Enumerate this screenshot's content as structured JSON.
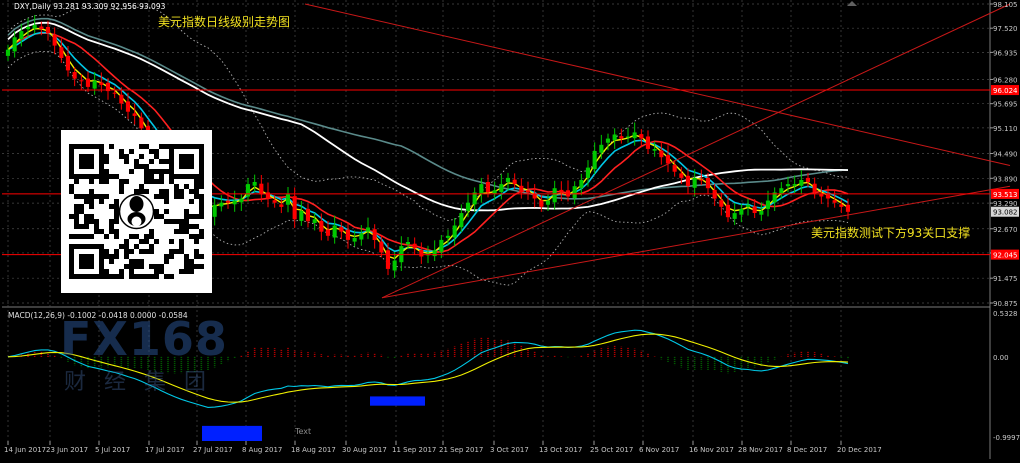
{
  "chart_header": {
    "symbol_info": "DXY,Daily  93.281 93.309 92.956 93.093"
  },
  "title_annotation": "美元指数日线级别走势图",
  "side_annotation": "美元指数测试下方93关口支撑",
  "macd_header": "MACD(12,26,9) -0.1002 -0.0418 0.0000 -0.0584",
  "macd_note": "Text",
  "watermark": {
    "logo_text": "FX168",
    "logo_sub": "财经集团"
  },
  "colors": {
    "background": "#000000",
    "grid": "#4a4a4a",
    "axis_text": "#c8c8c8",
    "annotation": "#f0e020",
    "hline": "#ff0000",
    "bull_candle": "#00c800",
    "bear_candle": "#ff0000",
    "ma_yellow": "#f0f000",
    "ma_cyan": "#00c8e6",
    "ma_red": "#ff2020",
    "ma_white": "#ffffff",
    "ma_slate": "#5a8a8a",
    "bands": "#b0b0b0",
    "macd_hist_pos": "#c80000",
    "macd_hist_neg": "#006400",
    "highlight": "#0020ff"
  },
  "chart_data": [
    {
      "type": "candlestick",
      "panel": "price",
      "ylim": [
        90.875,
        98.105
      ],
      "y_ticks": [
        "98.105",
        "97.520",
        "96.935",
        "96.280",
        "95.695",
        "95.110",
        "94.490",
        "93.890",
        "93.290",
        "92.670",
        "92.085",
        "91.475",
        "90.875"
      ],
      "price_labels": [
        {
          "label": "96.024",
          "value": 96.024
        },
        {
          "label": "93.513",
          "value": 93.513
        },
        {
          "label": "93.082",
          "value": 93.082
        },
        {
          "label": "92.045",
          "value": 92.045
        }
      ],
      "horizontal_lines": [
        96.024,
        93.513,
        92.045
      ],
      "x_labels": [
        "14 Jun 2017",
        "23 Jun 2017",
        "5 Jul 2017",
        "17 Jul 2017",
        "27 Jul 2017",
        "8 Aug 2017",
        "18 Aug 2017",
        "30 Aug 2017",
        "11 Sep 2017",
        "21 Sep 2017",
        "3 Oct 2017",
        "13 Oct 2017",
        "25 Oct 2017",
        "6 Nov 2017",
        "16 Nov 2017",
        "28 Nov 2017",
        "8 Dec 2017",
        "20 Dec 2017"
      ],
      "closes": [
        97.0,
        97.3,
        97.45,
        97.55,
        97.6,
        97.5,
        97.4,
        97.1,
        96.8,
        96.5,
        96.3,
        96.25,
        96.1,
        96.25,
        96.15,
        96.0,
        95.95,
        95.7,
        95.5,
        95.4,
        95.1,
        94.8,
        94.6,
        94.3,
        94.1,
        93.9,
        93.75,
        93.6,
        93.4,
        93.2,
        93.0,
        93.25,
        93.3,
        93.3,
        93.35,
        93.4,
        93.75,
        93.8,
        93.5,
        93.4,
        93.3,
        93.2,
        93.5,
        92.9,
        93.1,
        92.85,
        92.9,
        92.6,
        92.5,
        92.75,
        92.6,
        92.4,
        92.45,
        92.55,
        92.7,
        92.4,
        92.1,
        91.7,
        91.9,
        92.25,
        92.35,
        92.2,
        92.0,
        92.05,
        92.15,
        92.4,
        92.5,
        92.75,
        93.05,
        93.3,
        93.55,
        93.75,
        93.55,
        93.6,
        93.75,
        93.9,
        93.75,
        93.55,
        93.55,
        93.4,
        93.2,
        93.35,
        93.65,
        93.55,
        93.45,
        93.7,
        93.85,
        94.15,
        94.55,
        94.7,
        94.85,
        94.95,
        94.85,
        94.9,
        95.0,
        94.85,
        94.6,
        94.6,
        94.4,
        94.25,
        94.05,
        93.9,
        93.7,
        93.9,
        93.85,
        93.65,
        93.4,
        93.2,
        92.95,
        93.05,
        93.15,
        93.25,
        93.05,
        93.1,
        93.35,
        93.55,
        93.65,
        93.75,
        93.75,
        93.85,
        93.8,
        93.55,
        93.45,
        93.4,
        93.3,
        93.2,
        93.08
      ],
      "trendlines": [
        {
          "from": [
            "14 Jun 2017",
            98.105
          ],
          "to": [
            "20 Dec 2017",
            94.2
          ],
          "note": "descending resistance"
        },
        {
          "from": [
            "5 Sep 2017",
            91.0
          ],
          "to": [
            "21 Dec 2017",
            98.105
          ],
          "note": "rising channel upper"
        },
        {
          "from": [
            "5 Sep 2017",
            91.0
          ],
          "to": [
            "21 Dec 2017",
            93.7
          ],
          "note": "rising support"
        }
      ]
    },
    {
      "type": "line",
      "panel": "macd",
      "ylim": [
        -0.9997,
        0.5328
      ],
      "y_ticks": [
        "0.5328",
        "0.00",
        "-0.9997"
      ],
      "series_colors": {
        "signal": "#f0e020",
        "macd_line": "#00c8e6"
      },
      "highlight_boxes": [
        {
          "from": "27 Jul 2017",
          "to": "6 Aug 2017",
          "y_range": [
            -0.9997,
            -0.82
          ]
        },
        {
          "from": "7 Sep 2017",
          "to": "17 Sep 2017",
          "y_range": [
            -0.58,
            -0.47
          ]
        }
      ]
    }
  ]
}
